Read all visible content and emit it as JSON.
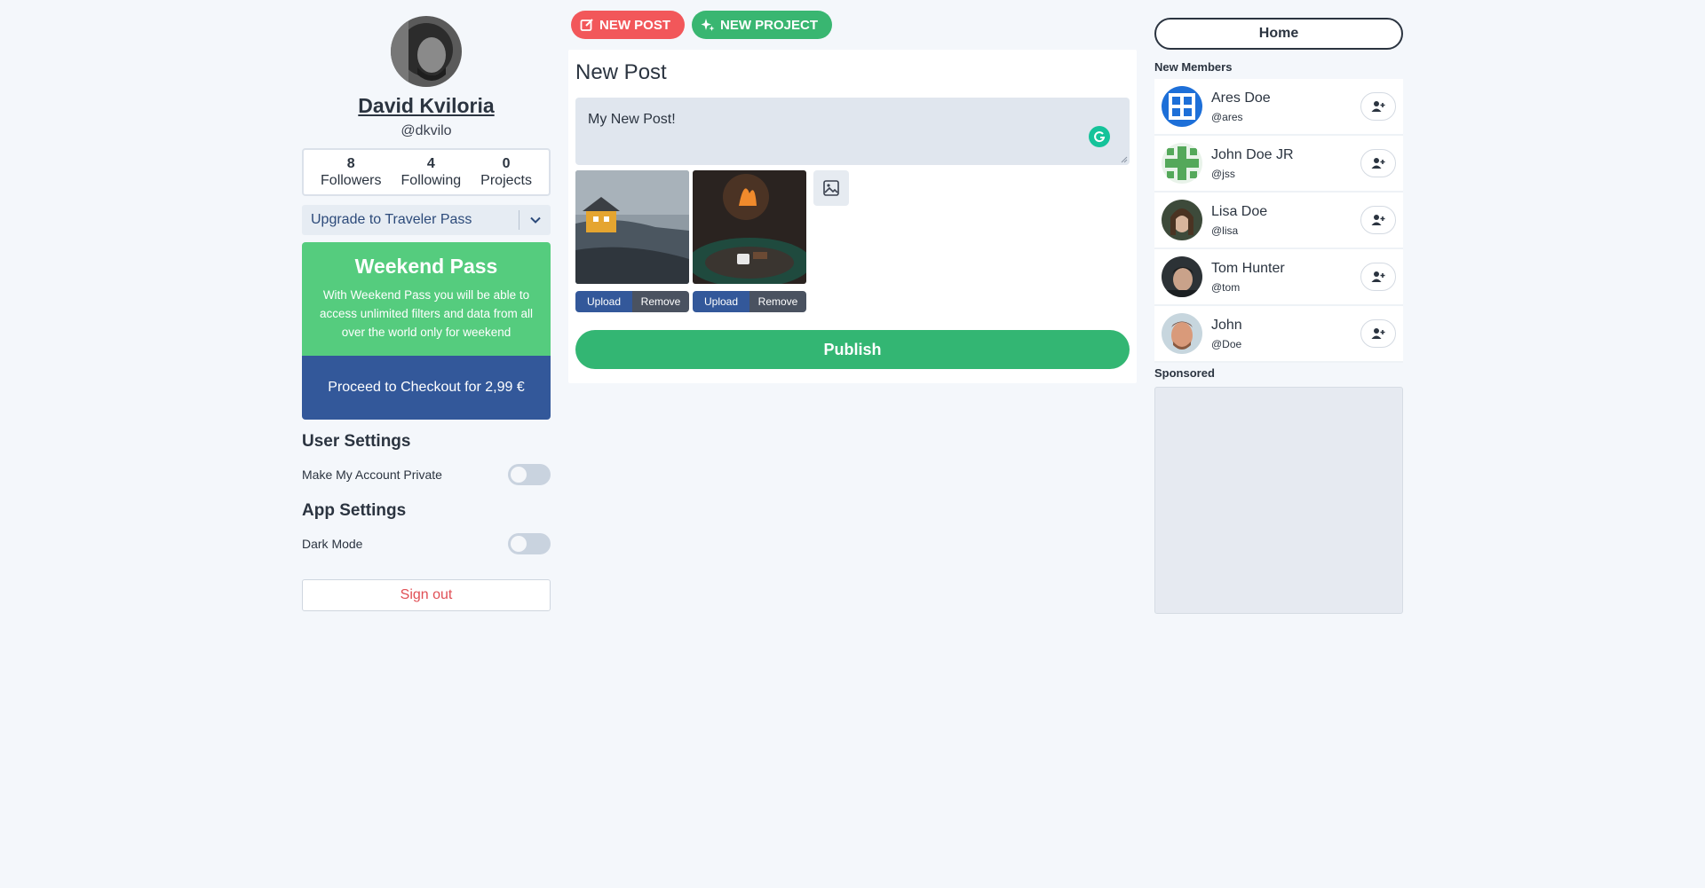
{
  "top_actions": {
    "new_post": "NEW POST",
    "new_project": "NEW PROJECT"
  },
  "profile": {
    "name": "David Kviloria",
    "handle": "@dkvilo",
    "stats": [
      {
        "value": "8",
        "label": "Followers"
      },
      {
        "value": "4",
        "label": "Following"
      },
      {
        "value": "0",
        "label": "Projects"
      }
    ]
  },
  "upgrade": {
    "selected": "Upgrade to Traveler Pass"
  },
  "pass": {
    "title": "Weekend Pass",
    "description": "With Weekend Pass you will be able to access unlimited filters and data from all over the world only for weekend",
    "checkout": "Proceed to Checkout for 2,99 €"
  },
  "user_settings": {
    "title": "User Settings",
    "private_label": "Make My Account Private",
    "private_on": false
  },
  "app_settings": {
    "title": "App Settings",
    "dark_mode_label": "Dark Mode",
    "dark_mode_on": false
  },
  "sign_out": "Sign out",
  "composer": {
    "title": "New Post",
    "text": "My New Post!",
    "upload_label": "Upload",
    "remove_label": "Remove",
    "publish": "Publish"
  },
  "sidebar": {
    "home": "Home",
    "new_members_title": "New Members",
    "members": [
      {
        "name": "Ares Doe",
        "handle": "@ares"
      },
      {
        "name": "John Doe JR",
        "handle": "@jss"
      },
      {
        "name": "Lisa Doe",
        "handle": "@lisa"
      },
      {
        "name": "Tom Hunter",
        "handle": "@tom"
      },
      {
        "name": "John",
        "handle": "@Doe"
      }
    ],
    "sponsored_title": "Sponsored"
  },
  "colors": {
    "accent_red": "#f2575a",
    "accent_green": "#39b671",
    "pass_green": "#55cc7e",
    "navy": "#33589a"
  }
}
